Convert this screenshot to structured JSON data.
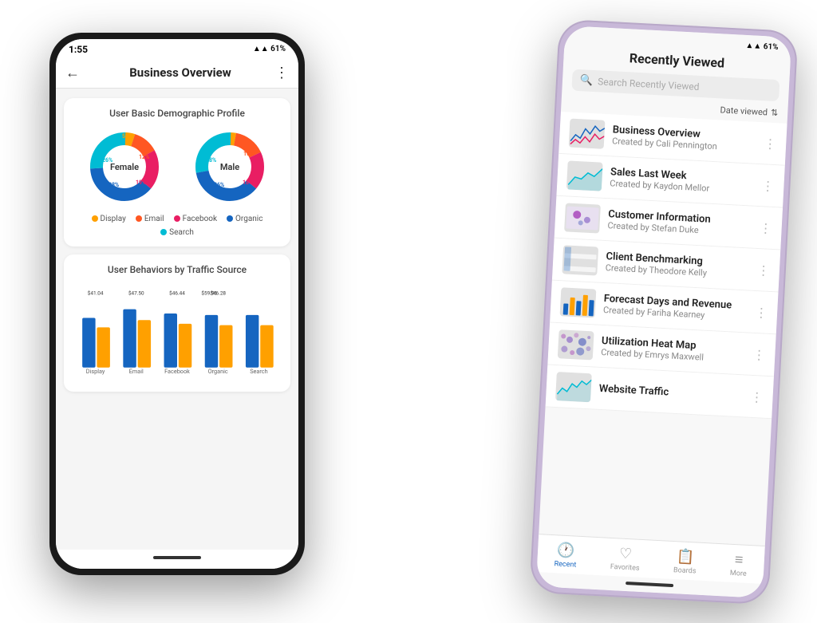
{
  "phone_left": {
    "status": {
      "time": "1:55",
      "icons": "▲▲ 61%"
    },
    "app_bar": {
      "title": "Business Overview",
      "back": "←",
      "more": "⋮"
    },
    "demographic_card": {
      "title": "User Basic Demographic Profile",
      "female_label": "Female",
      "male_label": "Male",
      "legend": [
        {
          "label": "Display",
          "color": "#FFA000"
        },
        {
          "label": "Email",
          "color": "#FF5722"
        },
        {
          "label": "Facebook",
          "color": "#E91E63"
        },
        {
          "label": "Organic",
          "color": "#1565C0"
        },
        {
          "label": "Search",
          "color": "#00BCD4"
        }
      ],
      "female_segments": [
        {
          "pct": 26,
          "color": "#00BCD4",
          "label": "26%"
        },
        {
          "pct": 38,
          "color": "#1565C0",
          "label": "38%"
        },
        {
          "pct": 19,
          "color": "#E91E63",
          "label": "19%"
        },
        {
          "pct": 12,
          "color": "#FF5722",
          "label": "12%"
        },
        {
          "pct": 5,
          "color": "#FFA000",
          "label": "5%"
        }
      ],
      "male_segments": [
        {
          "pct": 28,
          "color": "#00BCD4",
          "label": "28%"
        },
        {
          "pct": 36,
          "color": "#1565C0",
          "label": "36%"
        },
        {
          "pct": 18,
          "color": "#E91E63",
          "label": "18%"
        },
        {
          "pct": 15,
          "color": "#FF5722",
          "label": "15%"
        },
        {
          "pct": 3,
          "color": "#FFA000",
          "label": ""
        }
      ]
    },
    "traffic_card": {
      "title": "User Behaviors by Traffic Source",
      "bars": [
        {
          "label": "Display",
          "blue": 68,
          "gold": 55,
          "blue_val": "$41.04",
          "gold_val": ""
        },
        {
          "label": "Email",
          "blue": 78,
          "gold": 62,
          "blue_val": "$47.50",
          "gold_val": ""
        },
        {
          "label": "Facebook",
          "blue": 72,
          "gold": 52,
          "blue_val": "$46.44",
          "gold_val": "$59.96"
        },
        {
          "label": "Organic",
          "blue": 70,
          "gold": 55,
          "blue_val": "$46.28",
          "gold_val": ""
        },
        {
          "label": "Search",
          "blue": 70,
          "gold": 55,
          "blue_val": "",
          "gold_val": ""
        }
      ]
    }
  },
  "phone_right": {
    "status": {
      "time": "",
      "icons": "▲▲ 61%"
    },
    "screen_title": "Recently Viewed",
    "search_placeholder": "Search Recently Viewed",
    "filter_label": "Date viewed",
    "list_items": [
      {
        "title": "Business Overview",
        "subtitle": "Created by Cali Pennington",
        "thumb_type": "line"
      },
      {
        "title": "Sales Last Week",
        "subtitle": "Created by Kaydon Mellor",
        "thumb_type": "area"
      },
      {
        "title": "Customer Information",
        "subtitle": "Created by Stefan Duke",
        "thumb_type": "map"
      },
      {
        "title": "Client Benchmarking",
        "subtitle": "Created by Theodore Kelly",
        "thumb_type": "table"
      },
      {
        "title": "Forecast Days and Revenue",
        "subtitle": "Created by Fariha Kearney",
        "thumb_type": "bar"
      },
      {
        "title": "Utilization Heat Map",
        "subtitle": "Created by Emrys Maxwell",
        "thumb_type": "dots"
      },
      {
        "title": "Website Traffic",
        "subtitle": "",
        "thumb_type": "line2"
      }
    ],
    "nav": [
      {
        "label": "Recent",
        "icon": "🕐",
        "active": true
      },
      {
        "label": "Favorites",
        "icon": "♡",
        "active": false
      },
      {
        "label": "Boards",
        "icon": "📋",
        "active": false
      },
      {
        "label": "More",
        "icon": "≡",
        "active": false
      }
    ]
  }
}
